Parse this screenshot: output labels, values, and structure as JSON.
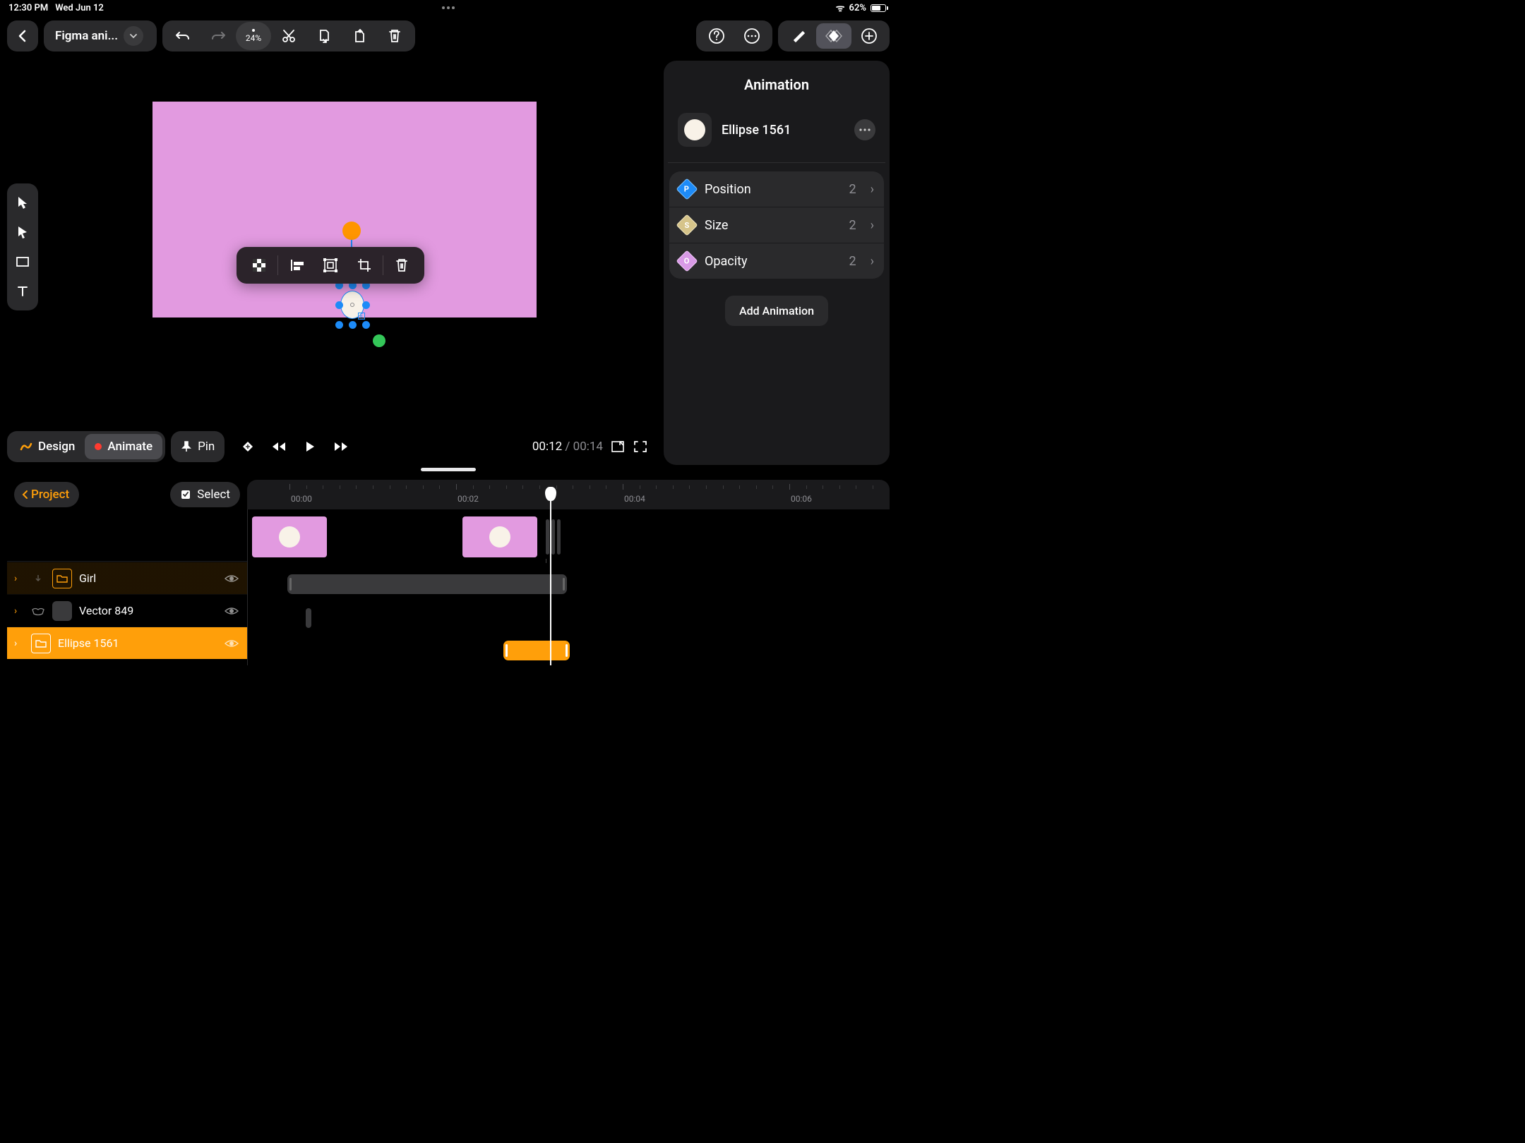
{
  "status": {
    "time": "12:30 PM",
    "date": "Wed Jun 12",
    "battery": "62%"
  },
  "toolbar": {
    "project_name": "Figma ani...",
    "zoom": "24%"
  },
  "context_bar": {},
  "animation_panel": {
    "title": "Animation",
    "object_name": "Ellipse 1561",
    "properties": [
      {
        "label": "Position",
        "count": "2",
        "letter": "P"
      },
      {
        "label": "Size",
        "count": "2",
        "letter": "S"
      },
      {
        "label": "Opacity",
        "count": "2",
        "letter": "O"
      }
    ],
    "add_label": "Add Animation"
  },
  "mode_bar": {
    "design": "Design",
    "animate": "Animate",
    "pin": "Pin",
    "time_current": "00:12",
    "time_total": "00:14"
  },
  "timeline": {
    "project_label": "Project",
    "select_label": "Select",
    "ticks": [
      "00:00",
      "00:02",
      "00:04",
      "00:06"
    ]
  },
  "layers": [
    {
      "name": "Girl",
      "selected": false,
      "type": "folder"
    },
    {
      "name": "Vector 849",
      "selected": false,
      "type": "mask"
    },
    {
      "name": "Ellipse 1561",
      "selected": true,
      "type": "folder"
    }
  ]
}
